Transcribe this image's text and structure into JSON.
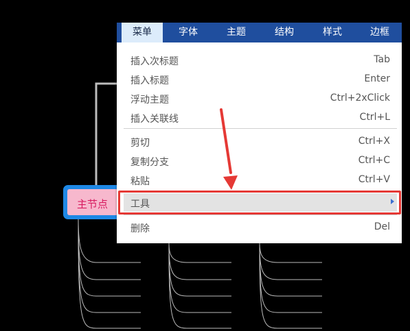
{
  "mindmap": {
    "main_node_label": "主节点"
  },
  "menu": {
    "tabs": [
      {
        "label": "菜单",
        "active": true
      },
      {
        "label": "字体",
        "active": false
      },
      {
        "label": "主题",
        "active": false
      },
      {
        "label": "结构",
        "active": false
      },
      {
        "label": "样式",
        "active": false
      },
      {
        "label": "边框",
        "active": false
      }
    ],
    "items": [
      {
        "label": "插入次标题",
        "shortcut": "Tab"
      },
      {
        "label": "插入标题",
        "shortcut": "Enter"
      },
      {
        "label": "浮动主题",
        "shortcut": "Ctrl+2xClick"
      },
      {
        "label": "插入关联线",
        "shortcut": "Ctrl+L"
      },
      {
        "label": "剪切",
        "shortcut": "Ctrl+X"
      },
      {
        "label": "复制分支",
        "shortcut": "Ctrl+C"
      },
      {
        "label": "粘贴",
        "shortcut": "Ctrl+V"
      },
      {
        "label": "工具",
        "shortcut": "",
        "has_submenu": true,
        "highlighted": true
      },
      {
        "label": "删除",
        "shortcut": "Del"
      }
    ]
  },
  "annotation": {
    "arrow_color": "#e53935",
    "highlight_color": "#e53935"
  },
  "colors": {
    "menu_bar": "#1f4e9e",
    "active_tab": "#dcecfb",
    "main_node_border": "#1e88e5",
    "main_node_fill": "#f7b8cd",
    "main_node_text": "#d81b60"
  }
}
